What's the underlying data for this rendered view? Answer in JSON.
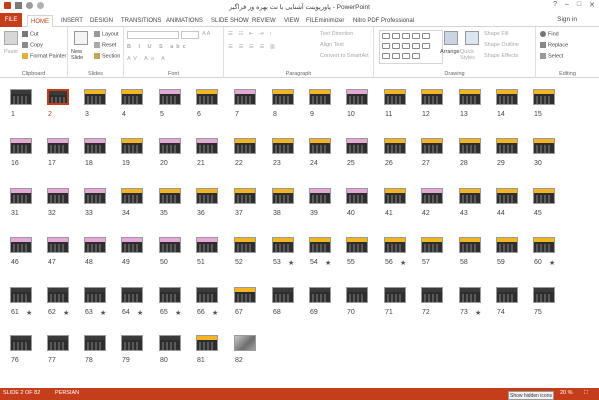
{
  "titlebar": {
    "title": "پاورپوینت آشنایی با نت بهره ور فراگیر - PowerPoint",
    "minimize": "–",
    "maximize": "□",
    "close": "✕",
    "help": "?"
  },
  "tabs": [
    "FILE",
    "HOME",
    "INSERT",
    "DESIGN",
    "TRANSITIONS",
    "ANIMATIONS",
    "SLIDE SHOW",
    "REVIEW",
    "VIEW",
    "FILEminimizer",
    "Nitro PDF Professional"
  ],
  "active_tab": "HOME",
  "sign_in": "Sign in",
  "ribbon": {
    "clipboard": {
      "label": "Clipboard",
      "paste": "Paste",
      "cut": "Cut",
      "copy": "Copy",
      "format_painter": "Format Painter"
    },
    "slides": {
      "label": "Slides",
      "new_slide": "New Slide",
      "layout": "Layout",
      "reset": "Reset",
      "section": "Section"
    },
    "font": {
      "label": "Font"
    },
    "paragraph": {
      "label": "Paragraph",
      "text_direction": "Text Direction",
      "align_text": "Align Text",
      "convert": "Convert to SmartArt"
    },
    "drawing": {
      "label": "Drawing",
      "arrange": "Arrange",
      "quick_styles": "Quick Styles",
      "shape_fill": "Shape Fill",
      "shape_outline": "Shape Outline",
      "shape_effects": "Shape Effects"
    },
    "editing": {
      "label": "Editing",
      "find": "Find",
      "replace": "Replace",
      "select": "Select"
    }
  },
  "slides": {
    "total": 82,
    "selected": 2,
    "starred": [
      53,
      54,
      56,
      60,
      61,
      62,
      63,
      64,
      65,
      66,
      73
    ],
    "yellow_header": [
      3,
      4,
      6,
      8,
      9,
      11,
      12,
      13,
      14,
      15,
      19,
      22,
      23,
      24,
      26,
      27,
      28,
      29,
      30,
      34,
      35,
      36,
      37,
      38,
      41,
      43,
      44,
      45,
      52,
      53,
      54,
      55,
      56,
      57,
      58,
      59,
      60,
      67,
      81
    ],
    "pink_header": [
      5,
      7,
      10,
      16,
      17,
      18,
      20,
      21,
      25,
      31,
      32,
      33,
      39,
      40,
      42,
      46,
      47,
      48,
      49,
      50,
      51
    ],
    "image_slide": 82
  },
  "statusbar": {
    "slide_info": "SLIDE 2 OF 82",
    "language": "PERSIAN",
    "zoom": "20 %",
    "tooltip": "Show hidden icons"
  },
  "colors": {
    "accent": "#c43e1c",
    "thumb_bg": "#2e2e2e",
    "yellow": "#f3b623",
    "pink": "#e6a8d6"
  }
}
